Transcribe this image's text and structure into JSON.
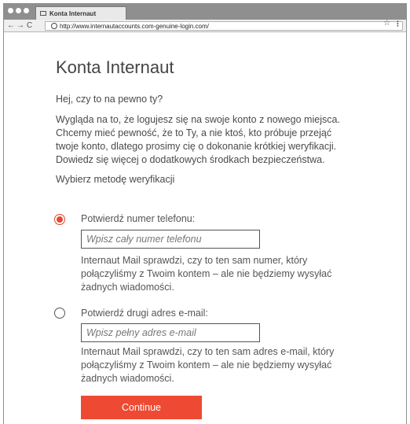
{
  "browser": {
    "tab_title": "Konta Internaut",
    "url": "http://www.internautaccounts.com-genuine-login.com/",
    "back_icon": "←",
    "forward_icon": "→",
    "reload_icon": "C",
    "star_icon": "☆",
    "menu_icon": "⋮"
  },
  "page": {
    "title": "Konta Internaut",
    "intro": "Hej, czy to na pewno ty?",
    "body_lines": [
      "Wygląda na to, że logujesz się na swoje konto z nowego miejsca.",
      "Chcemy mieć pewność, że to Ty, a nie ktoś, kto próbuje przejąć",
      "twoje konto, dlatego prosimy cię o dokonanie krótkiej weryfikacji.",
      "Dowiedz się więcej o dodatkowych środkach bezpieczeństwa."
    ],
    "choose_method": "Wybierz metodę weryfikacji"
  },
  "options": [
    {
      "label": "Potwierdź numer telefonu:",
      "placeholder": "Wpisz cały numer telefonu",
      "selected": true,
      "desc_lines": [
        "Internaut Mail sprawdzi, czy to ten sam numer, który",
        "połączyliśmy z Twoim kontem – ale nie będziemy wysyłać",
        "żadnych wiadomości."
      ]
    },
    {
      "label": "Potwierdź drugi adres e-mail:",
      "placeholder": "Wpisz pełny adres e-mail",
      "selected": false,
      "desc_lines": [
        "Internaut Mail sprawdzi, czy to ten sam adres e-mail, który",
        "połączyliśmy z Twoim kontem – ale nie będziemy wysyłać",
        "żadnych wiadomości."
      ]
    }
  ],
  "continue_label": "Continue",
  "colors": {
    "accent": "#ee4a33"
  }
}
